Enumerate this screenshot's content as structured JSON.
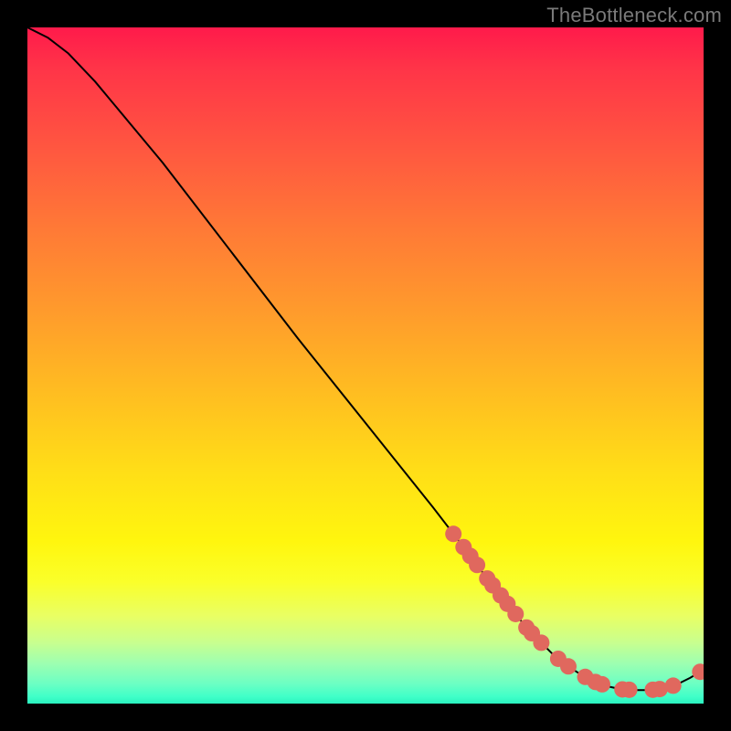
{
  "attribution": "TheBottleneck.com",
  "chart_data": {
    "type": "line",
    "title": "",
    "xlabel": "",
    "ylabel": "",
    "xlim": [
      0,
      100
    ],
    "ylim": [
      0,
      100
    ],
    "grid": false,
    "legend": false,
    "x": [
      0,
      3,
      6,
      10,
      15,
      20,
      30,
      40,
      50,
      60,
      65,
      68,
      70,
      72,
      74,
      76,
      78,
      80,
      82,
      84,
      86,
      88,
      90,
      92,
      94,
      96,
      98,
      100
    ],
    "values": [
      100,
      98.5,
      96.2,
      92,
      86,
      80,
      67,
      54,
      41.5,
      29,
      22.5,
      18.5,
      16,
      13.5,
      11,
      9,
      7,
      5.5,
      4.2,
      3.2,
      2.5,
      2.1,
      2.0,
      2.0,
      2.2,
      2.8,
      3.8,
      5.0
    ],
    "marker_points_x": [
      63,
      64.5,
      65.5,
      66.5,
      68,
      68.8,
      70,
      71,
      72.2,
      73.8,
      74.6,
      76,
      78.5,
      80,
      82.5,
      84,
      85,
      88,
      89,
      92.5,
      93.5,
      95.5,
      99.5
    ],
    "marker_style": {
      "color": "#e0685e",
      "size": 9
    }
  }
}
